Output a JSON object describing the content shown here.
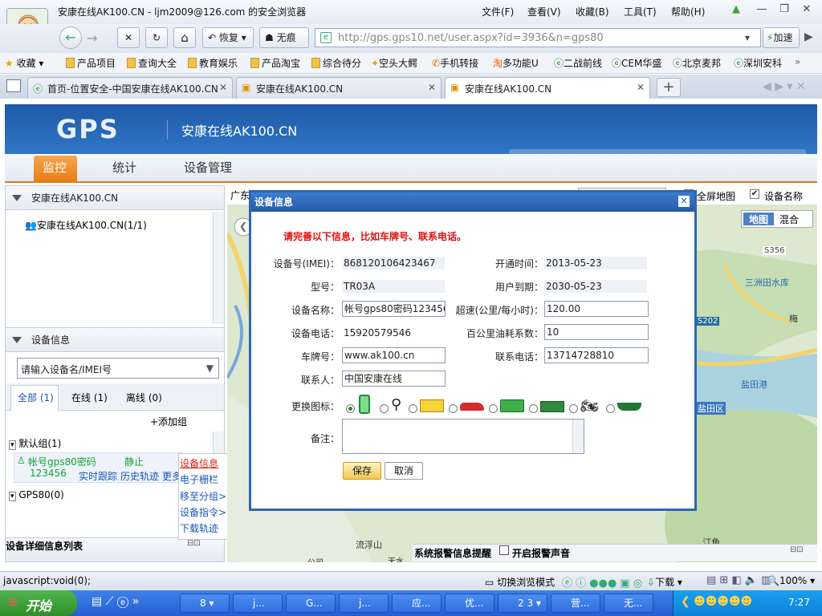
{
  "window": {
    "title": "安康在线AK100.CN - ljm2009@126.com 的安全浏览器",
    "menus": [
      "文件(F)",
      "查看(V)",
      "收藏(B)",
      "工具(T)",
      "帮助(H)"
    ],
    "controls": {
      "min": "—",
      "restore": "❐",
      "close": "✕"
    }
  },
  "toolbar": {
    "back": "←",
    "forward": "→",
    "stop": "✕",
    "refresh": "↻",
    "home": "⌂",
    "restore_label": "恢复",
    "notrace_label": "无痕",
    "address": "http://gps.gps10.net/user.aspx?id=3936&n=gps80",
    "accelerate": "加速"
  },
  "favorites": {
    "label": "收藏",
    "items": [
      "产品项目",
      "查询大全",
      "教育娱乐",
      "产品淘宝",
      "综合待分",
      "空头大鳄",
      "手机转接",
      "多功能U",
      "二战前线",
      "CEM华盛",
      "北京麦邦",
      "深圳安科"
    ],
    "more": "»"
  },
  "tabs": [
    {
      "label": "首页-位置安全-中国安康在线AK100.CN"
    },
    {
      "label": "安康在线AK100.CN"
    },
    {
      "label": "安康在线AK100.CN"
    }
  ],
  "new_tab": "+",
  "site": {
    "logo": "GPS",
    "name": "安康在线AK100.CN",
    "nav": [
      "监控",
      "统计",
      "设备管理"
    ]
  },
  "left": {
    "tree_header": "安康在线AK100.CN",
    "tree_item": "安康在线AK100.CN(1/1)",
    "device_header": "设备信息",
    "search_placeholder": "请输入设备名/IMEI号",
    "filter_tabs": [
      "全部 (1)",
      "在线 (1)",
      "离线 (0)"
    ],
    "add_group": "+添加组",
    "group1": "默认组(1)",
    "device_name": "帐号gps80密码",
    "device_name2": "123456",
    "device_status": "静止",
    "device_links": [
      "实时跟踪",
      "历史轨迹",
      "更多"
    ],
    "group2": "GPS80(0)",
    "detail_list": "设备详细信息列表"
  },
  "context_menu": [
    "设备信息",
    "电子栅栏",
    "移至分组>>",
    "设备指令>>",
    "下载轨迹"
  ],
  "map": {
    "top_text": "广东",
    "fullscreen": "全屏地图",
    "device_name_toggle": "设备名称",
    "type_map": "地图",
    "type_mixed": "混合",
    "labels": [
      "三洲田水库",
      "S356",
      "S202",
      "盐田港",
      "盐田区",
      "流浮山",
      "汀角",
      "梅",
      "天水",
      "公司"
    ],
    "alarm": "系统报警信息提醒",
    "alarm_sound": "开启报警声音"
  },
  "dialog": {
    "title": "设备信息",
    "notice": "请完善以下信息，比如车牌号、联系电话。",
    "fields": {
      "imei_label": "设备号(IMEI)：",
      "imei": "868120106423467",
      "open_label": "开通时间：",
      "open": "2013-05-23",
      "model_label": "型号：",
      "model": "TR03A",
      "expire_label": "用户到期：",
      "expire": "2030-05-23",
      "name_label": "设备名称：",
      "name": "帐号gps80密码123456",
      "speed_label": "超速(公里/每小时)：",
      "speed": "120.00",
      "phone_label": "设备电话：",
      "phone": "15920579546",
      "fuel_label": "百公里油耗系数：",
      "fuel": "10",
      "plate_label": "车牌号：",
      "plate": "www.ak100.cn",
      "contact_phone_label": "联系电话：",
      "contact_phone": "13714728810",
      "contact_label": "联系人：",
      "contact": "中国安康在线",
      "icon_label": "更换图标：",
      "remark_label": "备注："
    },
    "icons": [
      "phone-icon",
      "pin-icon",
      "truck-icon",
      "car-icon",
      "bus-icon",
      "lorry-icon",
      "motorcycle-icon",
      "ship-icon"
    ],
    "save": "保存",
    "cancel": "取消"
  },
  "status": {
    "left": "javascript:void(0);",
    "browse_mode": "切换浏览模式",
    "download": "下载",
    "zoom": "100%"
  },
  "taskbar": {
    "start": "开始",
    "tasks": [
      "8 ▾",
      "j...",
      "G...",
      "j...",
      "应...",
      "优...",
      "2 3 ▾",
      "营...",
      "无..."
    ],
    "clock": "7:27"
  },
  "colors": {
    "brand_blue": "#2c66b3",
    "nav_orange": "#e67c12",
    "notice_red": "#e01010",
    "online_green": "#14a32b"
  }
}
